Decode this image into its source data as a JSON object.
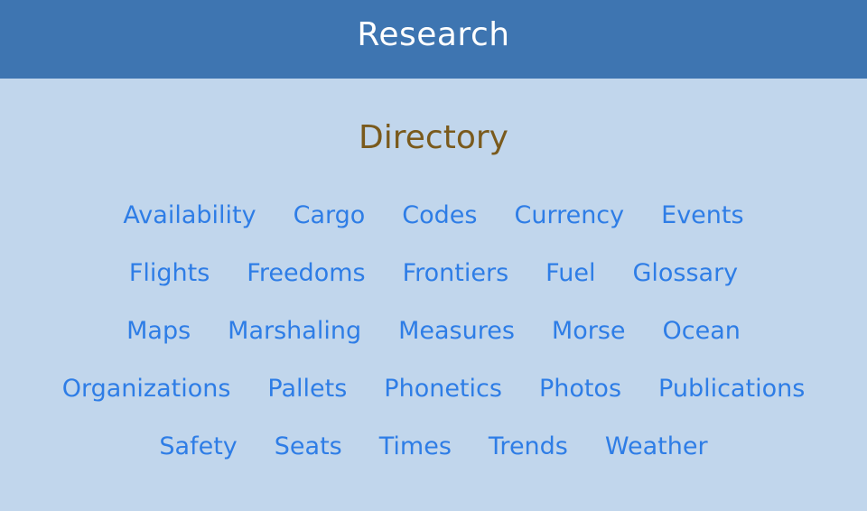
{
  "header": {
    "title": "Research"
  },
  "section": {
    "title": "Directory"
  },
  "directory": {
    "rows": [
      [
        "Availability",
        "Cargo",
        "Codes",
        "Currency",
        "Events"
      ],
      [
        "Flights",
        "Freedoms",
        "Frontiers",
        "Fuel",
        "Glossary"
      ],
      [
        "Maps",
        "Marshaling",
        "Measures",
        "Morse",
        "Ocean"
      ],
      [
        "Organizations",
        "Pallets",
        "Phonetics",
        "Photos",
        "Publications"
      ],
      [
        "Safety",
        "Seats",
        "Times",
        "Trends",
        "Weather"
      ]
    ]
  },
  "colors": {
    "header_bg": "#3e75b1",
    "page_bg": "#c1d6ec",
    "section_title": "#7a5a1c",
    "link": "#2e7de6"
  }
}
